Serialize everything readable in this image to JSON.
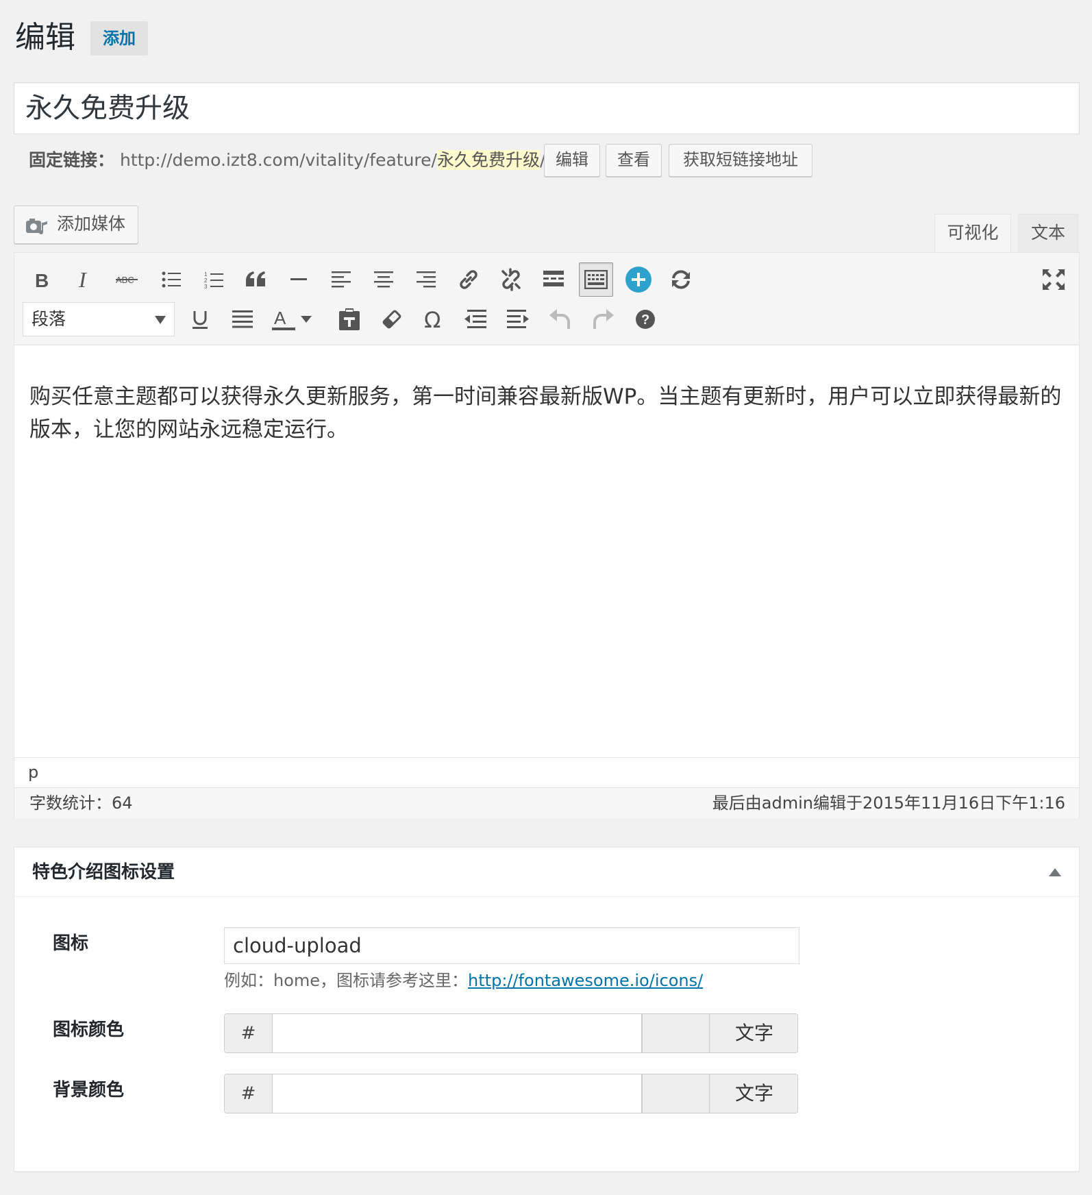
{
  "header": {
    "title": "编辑",
    "add_new": "添加"
  },
  "post": {
    "title": "永久免费升级",
    "permalink_label": "固定链接：",
    "permalink_base": "http://demo.izt8.com/vitality/feature/",
    "permalink_slug": "永久免费升级",
    "permalink_end": "/",
    "btn_edit": "编辑",
    "btn_view": "查看",
    "btn_shortlink": "获取短链接地址"
  },
  "editor": {
    "add_media": "添加媒体",
    "tab_visual": "可视化",
    "tab_text": "文本",
    "format_select": "段落",
    "content": "购买任意主题都可以获得永久更新服务，第一时间兼容最新版WP。当主题有更新时，用户可以立即获得最新的版本，让您的网站永远稳定运行。",
    "path": "p",
    "word_count": "字数统计：64",
    "last_edited": "最后由admin编辑于2015年11月16日下午1:16"
  },
  "toolbar_icons": [
    "bold-icon",
    "italic-icon",
    "strikethrough-icon",
    "bullet-list-icon",
    "numbered-list-icon",
    "blockquote-icon",
    "horizontal-rule-icon",
    "align-left-icon",
    "align-center-icon",
    "align-right-icon",
    "link-icon",
    "unlink-icon",
    "read-more-icon",
    "toolbar-toggle-icon",
    "plus-circle-icon",
    "refresh-icon",
    "fullscreen-icon",
    "underline-icon",
    "justify-icon",
    "text-color-icon",
    "paste-text-icon",
    "clear-formatting-icon",
    "special-char-icon",
    "outdent-icon",
    "indent-icon",
    "undo-icon",
    "redo-icon",
    "help-icon"
  ],
  "metabox": {
    "title": "特色介绍图标设置",
    "icon_label": "图标",
    "icon_value": "cloud-upload",
    "icon_desc": "例如：home，图标请参考这里：",
    "icon_link": "http://fontawesome.io/icons/",
    "icon_color_label": "图标颜色",
    "bg_color_label": "背景颜色",
    "hash": "#",
    "text_button": "文字"
  },
  "colors": {
    "accent": "#0073aa",
    "plus_icon": "#2ea2cc",
    "slug_highlight": "#fffbcc"
  }
}
